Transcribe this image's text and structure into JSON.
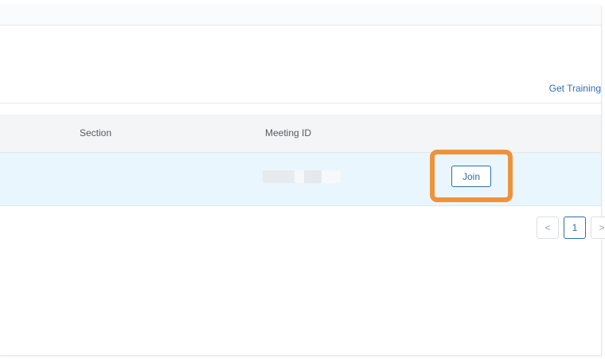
{
  "header": {
    "get_training_label": "Get Training"
  },
  "table": {
    "columns": [
      "Section",
      "Meeting ID"
    ],
    "rows": [
      {
        "section": "",
        "meeting_id": "",
        "action_label": "Join"
      }
    ]
  },
  "pagination": {
    "prev_label": "<",
    "current_page": "1",
    "next_label": ">"
  },
  "colors": {
    "accent_blue": "#2b6fb0",
    "highlight_orange": "#f0923b",
    "row_highlight": "#eaf6fd"
  }
}
